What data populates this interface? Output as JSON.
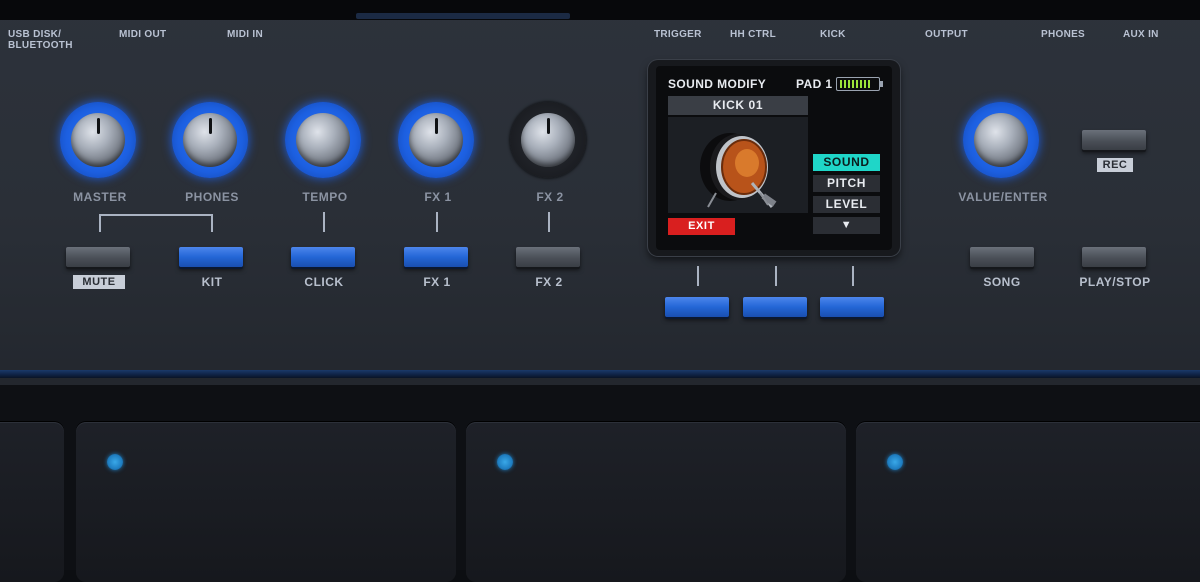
{
  "ports": {
    "usb_line1": "USB DISK/",
    "usb_line2": "BLUETOOTH",
    "midi_out": "MIDI OUT",
    "midi_in": "MIDI IN",
    "trigger": "TRIGGER",
    "hh_ctrl": "HH CTRL",
    "kick": "KICK",
    "output": "OUTPUT",
    "phones": "PHONES",
    "aux_in": "AUX IN"
  },
  "knobs": {
    "master": "MASTER",
    "phones": "PHONES",
    "tempo": "TEMPO",
    "fx1": "FX 1",
    "fx2": "FX 2",
    "value_enter": "VALUE/ENTER"
  },
  "buttons": {
    "mute": "MUTE",
    "kit": "KIT",
    "click": "CLICK",
    "fx1": "FX 1",
    "fx2": "FX 2",
    "rec": "REC",
    "song": "SONG",
    "play_stop": "PLAY/STOP"
  },
  "screen": {
    "title": "SOUND MODIFY",
    "pad": "PAD 1",
    "kit_name": "KICK 01",
    "options": [
      "SOUND",
      "PITCH",
      "LEVEL"
    ],
    "more": "▼",
    "exit": "EXIT",
    "battery_level": 0.85
  },
  "colors": {
    "accent_blue": "#2466d6",
    "screen_active": "#1fd6c8",
    "exit_red": "#d91f1f",
    "battery_green": "#9be23a"
  }
}
